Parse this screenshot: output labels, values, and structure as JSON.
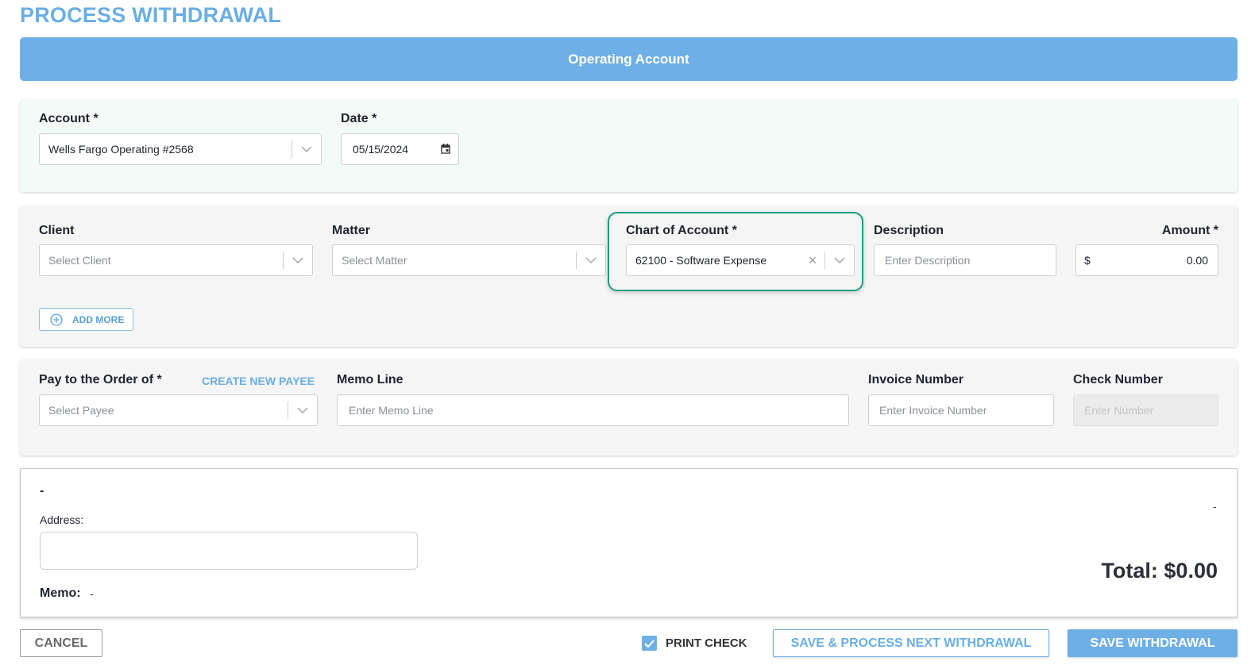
{
  "page": {
    "title": "PROCESS WITHDRAWAL"
  },
  "banner": {
    "label": "Operating Account"
  },
  "account_section": {
    "account_label": "Account *",
    "account_value": "Wells Fargo Operating #2568",
    "date_label": "Date *",
    "date_value": "05/15/2024"
  },
  "line_item": {
    "client_label": "Client",
    "client_placeholder": "Select Client",
    "matter_label": "Matter",
    "matter_placeholder": "Select Matter",
    "coa_label": "Chart of Account *",
    "coa_value": "62100 - Software Expense",
    "description_label": "Description",
    "description_placeholder": "Enter Description",
    "amount_label": "Amount *",
    "amount_currency": "$",
    "amount_value": "0.00",
    "add_more_label": "ADD MORE"
  },
  "payee_section": {
    "payee_label": "Pay to the Order of *",
    "create_payee_label": "CREATE NEW PAYEE",
    "payee_placeholder": "Select Payee",
    "memo_label": "Memo Line",
    "memo_placeholder": "Enter Memo Line",
    "invoice_label": "Invoice Number",
    "invoice_placeholder": "Enter Invoice Number",
    "check_label": "Check Number",
    "check_placeholder": "Enter Number"
  },
  "check_preview": {
    "payee_name": "-",
    "top_right_value": "-",
    "address_label": "Address:",
    "memo_label": "Memo:",
    "memo_value": "-",
    "total_text": "Total: $0.00"
  },
  "footer": {
    "cancel_label": "CANCEL",
    "print_check_label": "PRINT CHECK",
    "print_check_checked": true,
    "save_next_label": "SAVE & PROCESS NEXT WITHDRAWAL",
    "save_label": "SAVE WITHDRAWAL"
  },
  "colors": {
    "accent": "#6eb0e5",
    "highlight": "#1a9e82",
    "title": "#6aaee3"
  }
}
